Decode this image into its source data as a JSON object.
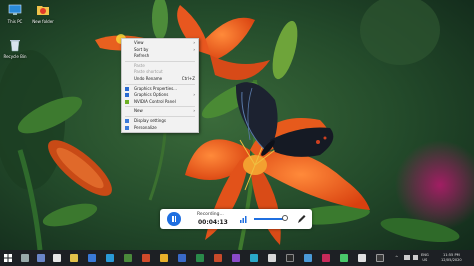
{
  "desktop_icons": [
    {
      "id": "this-pc",
      "label": "This PC",
      "icon": "computer-icon"
    },
    {
      "id": "new-folder",
      "label": "New folder",
      "icon": "folder-icon"
    },
    {
      "id": "recycle-bin",
      "label": "Recycle Bin",
      "icon": "recycle-bin-icon"
    }
  ],
  "context_menu": {
    "items": [
      {
        "label": "View",
        "submenu": true
      },
      {
        "label": "Sort by",
        "submenu": true
      },
      {
        "label": "Refresh"
      },
      {
        "separator": true
      },
      {
        "label": "Paste",
        "disabled": true
      },
      {
        "label": "Paste shortcut",
        "disabled": true
      },
      {
        "label": "Undo Rename",
        "shortcut": "Ctrl+Z"
      },
      {
        "separator": true
      },
      {
        "label": "Graphics Properties...",
        "icon": "intel-graphics-icon"
      },
      {
        "label": "Graphics Options",
        "icon": "intel-graphics-icon",
        "submenu": true
      },
      {
        "label": "NVIDIA Control Panel",
        "icon": "nvidia-icon"
      },
      {
        "separator": true
      },
      {
        "label": "New",
        "submenu": true
      },
      {
        "separator": true
      },
      {
        "label": "Display settings",
        "icon": "display-icon"
      },
      {
        "label": "Personalize",
        "icon": "personalize-icon"
      }
    ]
  },
  "recorder": {
    "status": "Recording...",
    "time": "00:04:13",
    "volume_level": 0.9
  },
  "taskbar": {
    "language": "ENG",
    "region": "US",
    "time": "11:55 PM",
    "date": "12/05/2020"
  },
  "colors": {
    "accent": "#1f6fe0",
    "flower": "#e6531a",
    "taskbar": "#1d2024"
  }
}
